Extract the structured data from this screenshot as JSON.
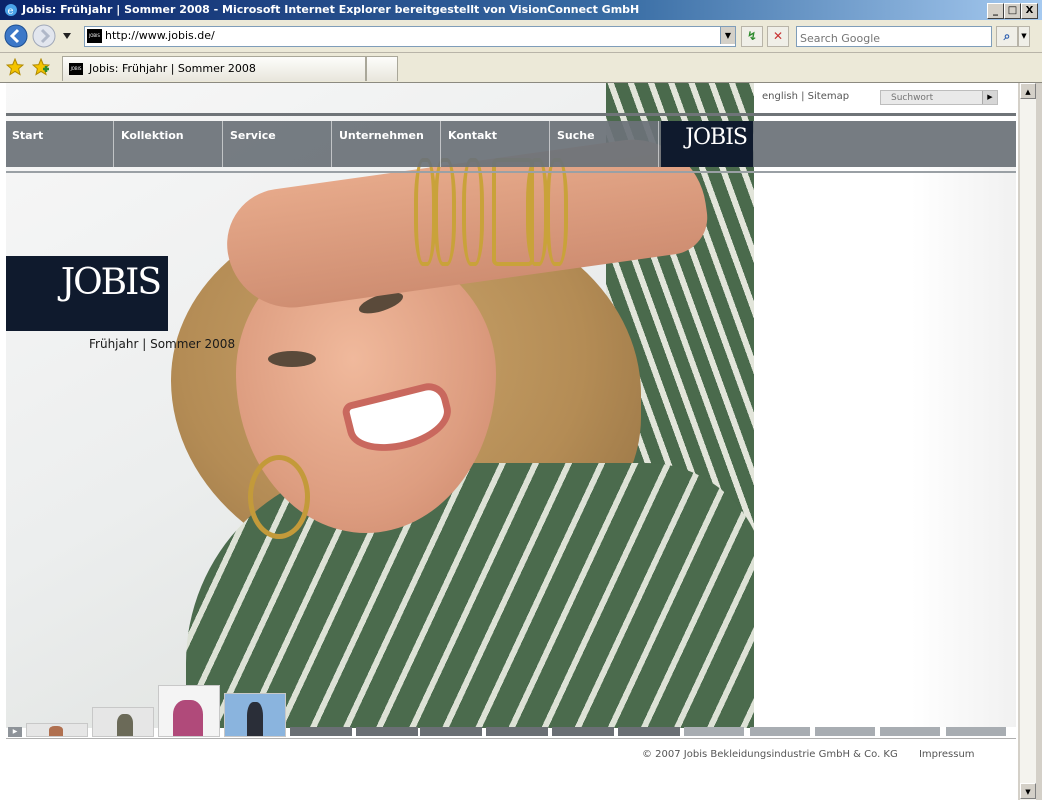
{
  "window": {
    "title": "Jobis: Frühjahr | Sommer 2008 - Microsoft Internet Explorer bereitgestellt von VisionConnect GmbH",
    "minimize": "_",
    "maximize": "□",
    "close": "X"
  },
  "toolbar": {
    "url": "http://www.jobis.de/",
    "search_placeholder": "Search Google",
    "favicon_text": "JOBIS"
  },
  "tabs": [
    {
      "label": "Jobis: Frühjahr | Sommer 2008"
    }
  ],
  "site": {
    "toplinks": "english | Sitemap",
    "search_placeholder": "Suchwort",
    "nav": [
      "Start",
      "Kollektion",
      "Service",
      "Unternehmen",
      "Kontakt",
      "Suche"
    ],
    "nav_logo": "JOBIS",
    "logo": "JOBIS",
    "season": "Frühjahr | Sommer 2008",
    "footer_copyright": "© 2007 Jobis Bekleidungsindustrie GmbH & Co. KG",
    "footer_impressum": "Impressum"
  },
  "colors": {
    "nav_bg": "#6c7278",
    "logo_bg": "#0f1a2d",
    "jacket_green": "#4a6a4c"
  },
  "icons": [
    "ie-icon",
    "back-icon",
    "forward-icon",
    "refresh-icon",
    "stop-icon",
    "search-go-icon",
    "favorites-star-icon",
    "add-favorites-icon",
    "play-icon"
  ]
}
